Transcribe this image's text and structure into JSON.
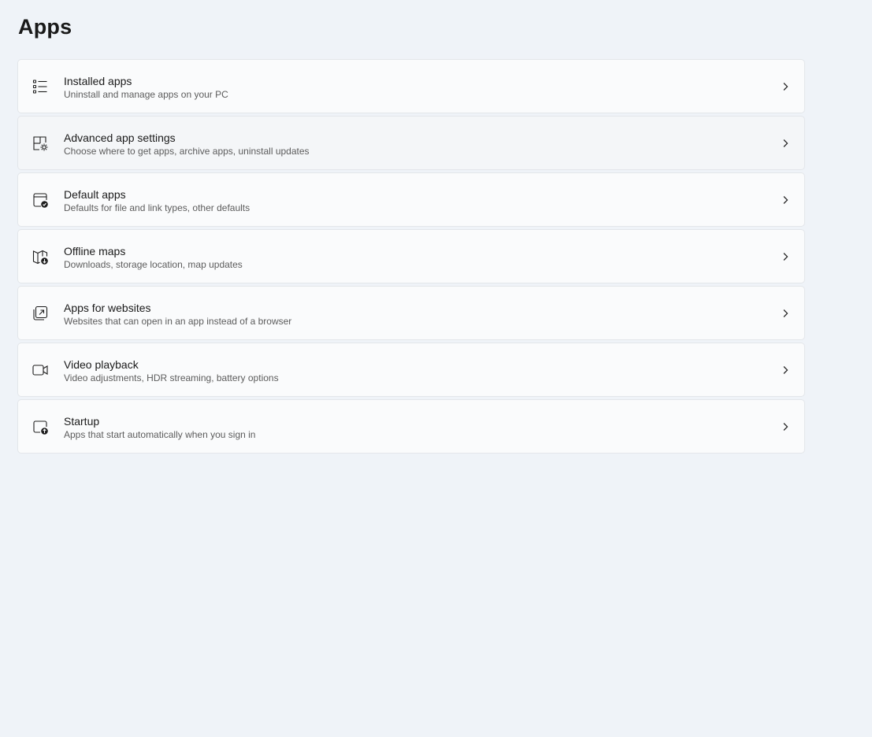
{
  "page": {
    "title": "Apps"
  },
  "items": [
    {
      "title": "Installed apps",
      "description": "Uninstall and manage apps on your PC",
      "icon": "list-icon"
    },
    {
      "title": "Advanced app settings",
      "description": "Choose where to get apps, archive apps, uninstall updates",
      "icon": "app-settings-icon"
    },
    {
      "title": "Default apps",
      "description": "Defaults for file and link types, other defaults",
      "icon": "default-apps-icon"
    },
    {
      "title": "Offline maps",
      "description": "Downloads, storage location, map updates",
      "icon": "map-download-icon"
    },
    {
      "title": "Apps for websites",
      "description": "Websites that can open in an app instead of a browser",
      "icon": "open-in-app-icon"
    },
    {
      "title": "Video playback",
      "description": "Video adjustments, HDR streaming, battery options",
      "icon": "video-camera-icon"
    },
    {
      "title": "Startup",
      "description": "Apps that start automatically when you sign in",
      "icon": "startup-icon"
    }
  ],
  "colors": {
    "background": "#eff3f8",
    "card": "#fafbfc",
    "card_hover": "#f4f6f8",
    "card_border": "#e3e6ea",
    "secondary_text": "#5c5c5c"
  }
}
